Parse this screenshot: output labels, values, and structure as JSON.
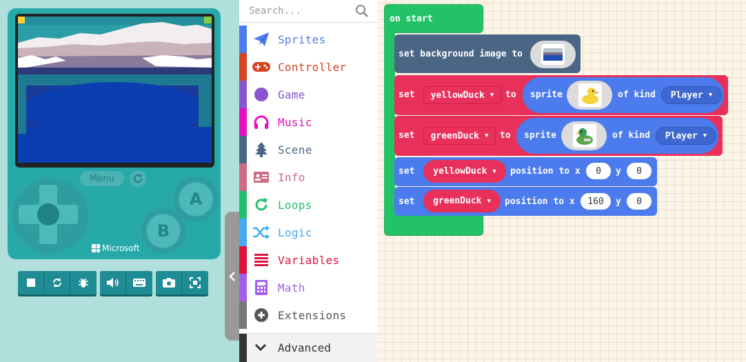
{
  "simulator": {
    "menu_label": "Menu",
    "button_a": "A",
    "button_b": "B",
    "brand": "Microsoft",
    "toolbar": [
      {
        "icon": "stop-icon"
      },
      {
        "icon": "restart-icon"
      },
      {
        "icon": "debug-icon"
      },
      {
        "icon": "mute-icon"
      },
      {
        "icon": "keyboard-icon"
      },
      {
        "icon": "screenshot-icon"
      },
      {
        "icon": "fullscreen-icon"
      }
    ]
  },
  "search": {
    "placeholder": "Search..."
  },
  "categories": [
    {
      "label": "Sprites",
      "color": "#4b7bec",
      "icon": "paper-plane-icon"
    },
    {
      "label": "Controller",
      "color": "#d54322",
      "icon": "gamepad-icon"
    },
    {
      "label": "Game",
      "color": "#8854d0",
      "icon": "circle-icon"
    },
    {
      "label": "Music",
      "color": "#e30fc0",
      "icon": "headphones-icon"
    },
    {
      "label": "Scene",
      "color": "#4b6584",
      "icon": "tree-icon"
    },
    {
      "label": "Info",
      "color": "#cf6a87",
      "icon": "id-card-icon"
    },
    {
      "label": "Loops",
      "color": "#20bf6b",
      "icon": "loop-icon"
    },
    {
      "label": "Logic",
      "color": "#45aaf2",
      "icon": "shuffle-icon"
    },
    {
      "label": "Variables",
      "color": "#dc143c",
      "icon": "list-icon"
    },
    {
      "label": "Math",
      "color": "#a55eea",
      "icon": "calculator-icon"
    },
    {
      "label": "Extensions",
      "color": "#777777",
      "icon": "plus-circle-icon"
    }
  ],
  "advanced": {
    "label": "Advanced",
    "icon": "chevron-down-icon"
  },
  "blocks": {
    "on_start": "on start",
    "set_background": "set background image to",
    "set_kw": "set",
    "to_kw": "to",
    "sprite_kw": "sprite",
    "of_kind_kw": "of kind",
    "position_to_x": "position to x",
    "y_kw": "y",
    "var_yellow": "yellowDuck",
    "var_green": "greenDuck",
    "kind": "Player",
    "yellow_x": "0",
    "yellow_y": "0",
    "green_x": "160",
    "green_y": "0"
  }
}
